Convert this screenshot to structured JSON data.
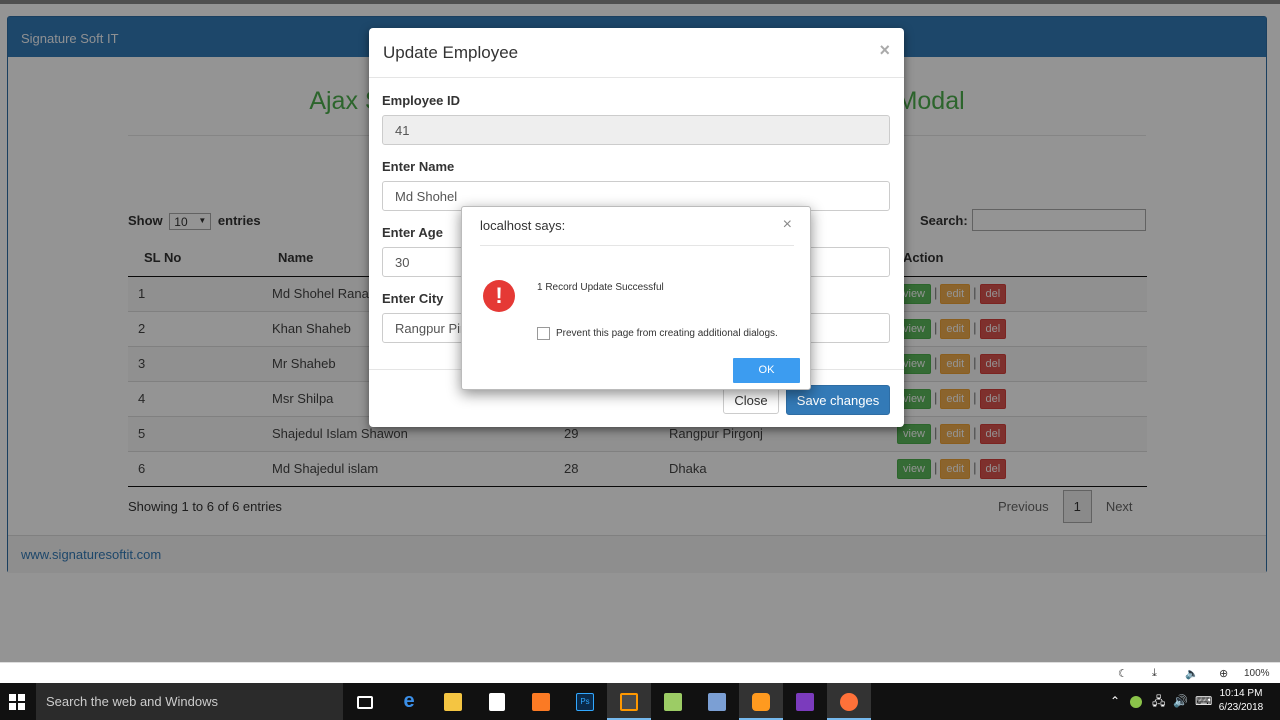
{
  "panel": {
    "brand": "Signature Soft IT",
    "footer_link": "www.signaturesoftit.com"
  },
  "page_title": "Ajax S                                                                            Modal",
  "title_left": "Ajax S",
  "title_right": "Modal",
  "table_controls": {
    "show_label": "Show",
    "entries_value": "10",
    "entries_label": "entries",
    "search_label": "Search:"
  },
  "table": {
    "headers": [
      "SL No",
      "Name",
      "",
      "",
      "Action"
    ],
    "rows": [
      {
        "sl": "1",
        "name": "Md Shohel Rana",
        "age": "",
        "city": ""
      },
      {
        "sl": "2",
        "name": "Khan Shaheb",
        "age": "",
        "city": ""
      },
      {
        "sl": "3",
        "name": "Mr Shaheb",
        "age": "",
        "city": ""
      },
      {
        "sl": "4",
        "name": "Msr Shilpa",
        "age": "",
        "city": ""
      },
      {
        "sl": "5",
        "name": "Shajedul Islam Shawon",
        "age": "29",
        "city": "Rangpur Pirgonj"
      },
      {
        "sl": "6",
        "name": "Md Shajedul islam",
        "age": "28",
        "city": "Dhaka"
      }
    ],
    "actions": {
      "view": "view",
      "edit": "edit",
      "del": "del",
      "sep": "|"
    }
  },
  "pager": {
    "info": "Showing 1 to 6 of 6 entries",
    "previous": "Previous",
    "current": "1",
    "next": "Next"
  },
  "modal": {
    "title": "Update Employee",
    "close_x": "×",
    "fields": {
      "id_label": "Employee ID",
      "id_value": "41",
      "name_label": "Enter Name",
      "name_value": "Md Shohel",
      "age_label": "Enter Age",
      "age_value": "30",
      "city_label": "Enter City",
      "city_value": "Rangpur Pir"
    },
    "close_button": "Close",
    "save_button": "Save changes"
  },
  "alert": {
    "title": "localhost says:",
    "close_x": "×",
    "message": "1 Record Update Successful",
    "checkbox_label": "Prevent this page from creating additional dialogs.",
    "ok_button": "OK",
    "icon": "error-icon"
  },
  "statusbar": {
    "zoom": "100%"
  },
  "taskbar": {
    "search_placeholder": "Search the web and Windows",
    "time": "10:14 PM",
    "date": "6/23/2018"
  },
  "colors": {
    "brand": "#337ab7",
    "title_green": "#4cae4c",
    "view": "#5cb85c",
    "edit": "#f0ad4e",
    "del": "#d9534f",
    "ok": "#3c9cf0"
  }
}
